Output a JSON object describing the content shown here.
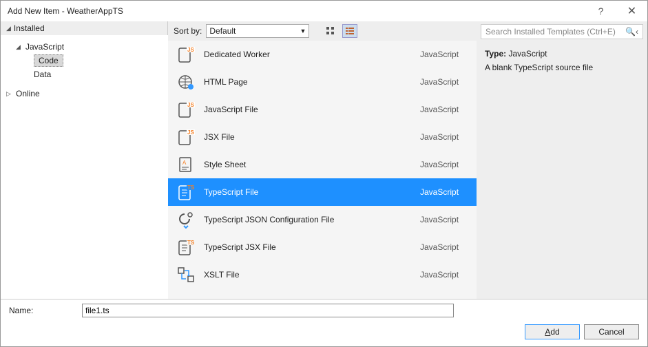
{
  "title": "Add New Item - WeatherAppTS",
  "sidebar": {
    "installed": "Installed",
    "javascript": "JavaScript",
    "code": "Code",
    "data": "Data",
    "online": "Online"
  },
  "toolbar": {
    "sortby_label": "Sort by:",
    "sortby_value": "Default"
  },
  "templates": {
    "items": [
      {
        "name": "Dedicated Worker",
        "category": "JavaScript",
        "icon": "js",
        "selected": false
      },
      {
        "name": "HTML Page",
        "category": "JavaScript",
        "icon": "html",
        "selected": false
      },
      {
        "name": "JavaScript File",
        "category": "JavaScript",
        "icon": "js",
        "selected": false
      },
      {
        "name": "JSX File",
        "category": "JavaScript",
        "icon": "js",
        "selected": false
      },
      {
        "name": "Style Sheet",
        "category": "JavaScript",
        "icon": "css",
        "selected": false
      },
      {
        "name": "TypeScript File",
        "category": "JavaScript",
        "icon": "ts",
        "selected": true
      },
      {
        "name": "TypeScript JSON Configuration File",
        "category": "JavaScript",
        "icon": "json",
        "selected": false
      },
      {
        "name": "TypeScript JSX File",
        "category": "JavaScript",
        "icon": "ts",
        "selected": false
      },
      {
        "name": "XSLT File",
        "category": "JavaScript",
        "icon": "xslt",
        "selected": false
      }
    ]
  },
  "search": {
    "placeholder": "Search Installed Templates (Ctrl+E)"
  },
  "details": {
    "type_label": "Type:",
    "type_value": "JavaScript",
    "description": "A blank TypeScript source file"
  },
  "name_field": {
    "label": "Name:",
    "value": "file1.ts"
  },
  "buttons": {
    "add": "Add",
    "cancel": "Cancel"
  }
}
